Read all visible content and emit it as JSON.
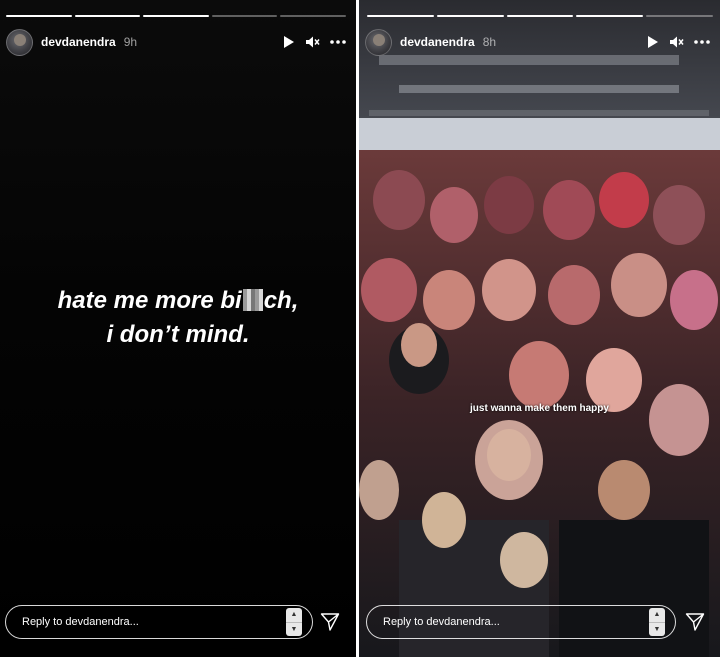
{
  "stories": [
    {
      "username": "devdanendra",
      "time": "9h",
      "progress": [
        1,
        1,
        1,
        0,
        0
      ],
      "caption_line1_start": "hate me more bi",
      "caption_line1_end": "ch,",
      "caption_line2": "i don’t mind.",
      "reply_placeholder": "Reply to devdanendra..."
    },
    {
      "username": "devdanendra",
      "time": "8h",
      "progress": [
        1,
        1,
        1,
        1,
        0
      ],
      "caption": "just wanna make them happy",
      "reply_placeholder": "Reply to devdanendra..."
    }
  ],
  "icons": {
    "play": "play-icon",
    "mute": "volume-muted-icon",
    "more": "more-options-icon",
    "send": "send-icon",
    "stepper": "stepper-icon"
  }
}
